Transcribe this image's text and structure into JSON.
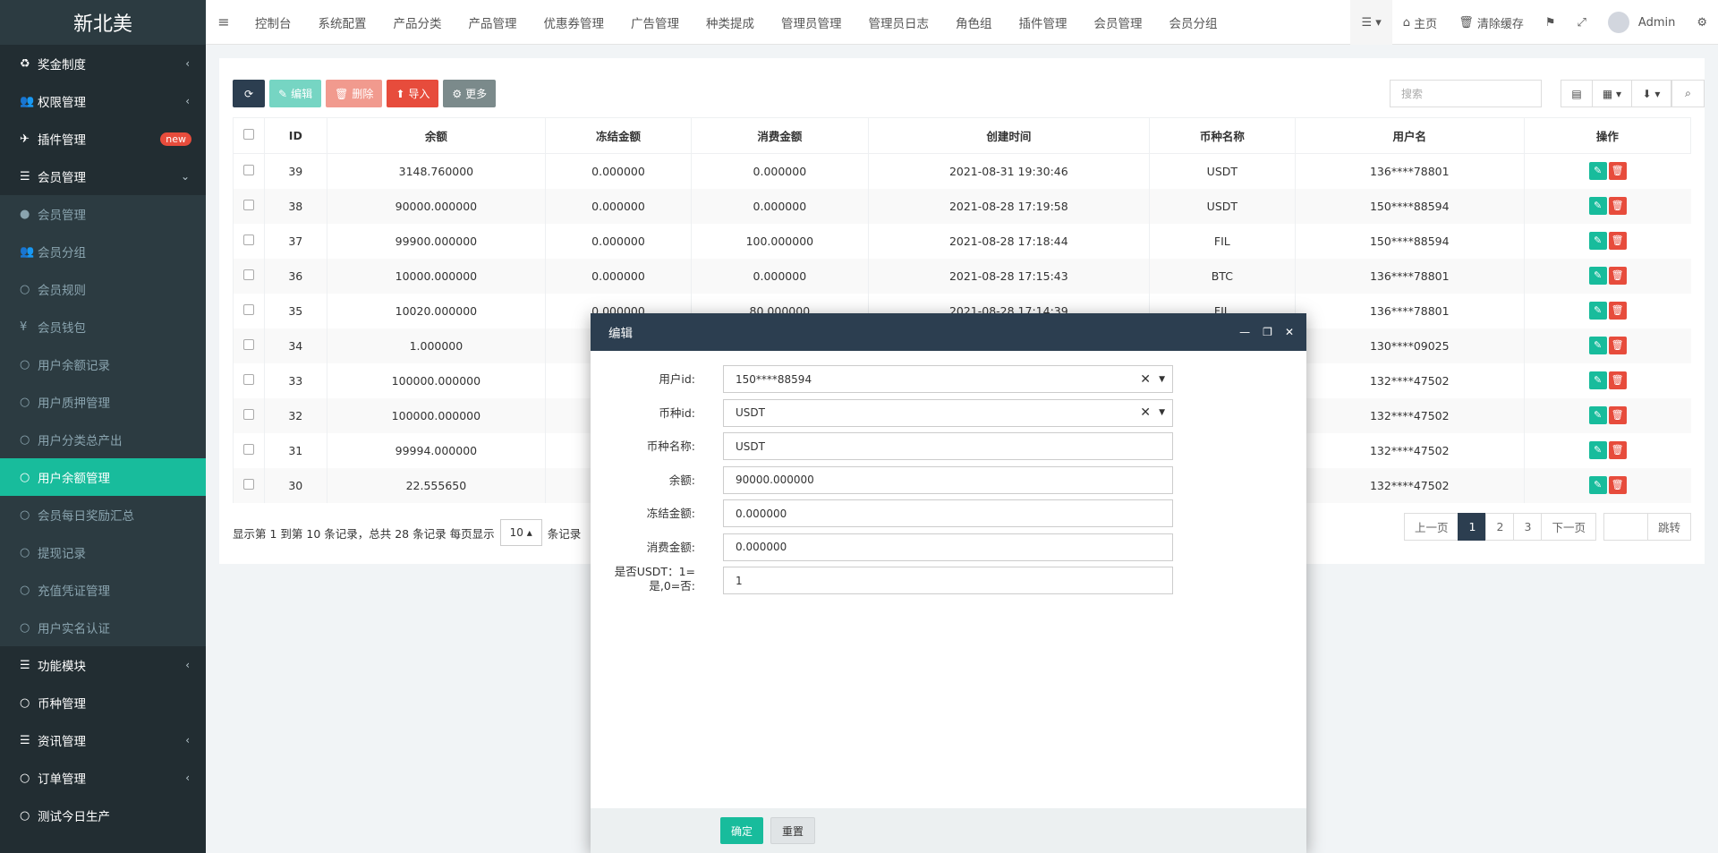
{
  "sidebar": {
    "brand": "新北美",
    "items": [
      {
        "label": "奖金制度",
        "icon": "recycle-icon",
        "glyph": "♻",
        "type": "top",
        "arrow": "‹"
      },
      {
        "label": "权限管理",
        "icon": "users-icon",
        "glyph": "👥",
        "type": "top",
        "arrow": "‹"
      },
      {
        "label": "插件管理",
        "icon": "rocket-icon",
        "glyph": "✈",
        "type": "top",
        "badge": "new"
      },
      {
        "label": "会员管理",
        "icon": "list-icon",
        "glyph": "☰",
        "type": "top",
        "arrow": "⌄"
      },
      {
        "label": "会员管理",
        "icon": "user-icon",
        "glyph": "●",
        "type": "sub"
      },
      {
        "label": "会员分组",
        "icon": "users-icon",
        "glyph": "👥",
        "type": "sub"
      },
      {
        "label": "会员规则",
        "icon": "circle-icon",
        "glyph": "○",
        "type": "sub"
      },
      {
        "label": "会员钱包",
        "icon": "yen-icon",
        "glyph": "¥",
        "type": "sub"
      },
      {
        "label": "用户余额记录",
        "icon": "circle-icon",
        "glyph": "○",
        "type": "sub"
      },
      {
        "label": "用户质押管理",
        "icon": "circle-icon",
        "glyph": "○",
        "type": "sub"
      },
      {
        "label": "用户分类总产出",
        "icon": "circle-icon",
        "glyph": "○",
        "type": "sub"
      },
      {
        "label": "用户余额管理",
        "icon": "circle-icon",
        "glyph": "○",
        "type": "active"
      },
      {
        "label": "会员每日奖励汇总",
        "icon": "circle-icon",
        "glyph": "○",
        "type": "sub"
      },
      {
        "label": "提现记录",
        "icon": "circle-icon",
        "glyph": "○",
        "type": "sub"
      },
      {
        "label": "充值凭证管理",
        "icon": "circle-icon",
        "glyph": "○",
        "type": "sub"
      },
      {
        "label": "用户实名认证",
        "icon": "circle-icon",
        "glyph": "○",
        "type": "sub"
      },
      {
        "label": "功能模块",
        "icon": "list-icon",
        "glyph": "☰",
        "type": "top",
        "arrow": "‹"
      },
      {
        "label": "币种管理",
        "icon": "circle-icon",
        "glyph": "○",
        "type": "top"
      },
      {
        "label": "资讯管理",
        "icon": "list-icon",
        "glyph": "☰",
        "type": "top",
        "arrow": "‹"
      },
      {
        "label": "订单管理",
        "icon": "circle-icon",
        "glyph": "○",
        "type": "top",
        "arrow": "‹"
      },
      {
        "label": "测试今日生产",
        "icon": "circle-icon",
        "glyph": "○",
        "type": "top"
      }
    ]
  },
  "topnav": {
    "toggle": "≡",
    "items": [
      "控制台",
      "系统配置",
      "产品分类",
      "产品管理",
      "优惠券管理",
      "广告管理",
      "种类提成",
      "管理员管理",
      "管理员日志",
      "角色组",
      "插件管理",
      "会员管理",
      "会员分组"
    ],
    "home": "主页",
    "clear_cache": "清除缓存",
    "user": "Admin"
  },
  "toolbar": {
    "refresh": "⟳",
    "edit": "编辑",
    "delete": "删除",
    "import": "导入",
    "more": "更多",
    "search_placeholder": "搜索"
  },
  "table": {
    "columns": [
      "",
      "ID",
      "余额",
      "冻结金额",
      "消费金额",
      "创建时间",
      "币种名称",
      "用户名",
      "操作"
    ],
    "rows": [
      [
        "39",
        "3148.760000",
        "0.000000",
        "0.000000",
        "2021-08-31 19:30:46",
        "USDT",
        "136****78801"
      ],
      [
        "38",
        "90000.000000",
        "0.000000",
        "0.000000",
        "2021-08-28 17:19:58",
        "USDT",
        "150****88594"
      ],
      [
        "37",
        "99900.000000",
        "0.000000",
        "100.000000",
        "2021-08-28 17:18:44",
        "FIL",
        "150****88594"
      ],
      [
        "36",
        "10000.000000",
        "0.000000",
        "0.000000",
        "2021-08-28 17:15:43",
        "BTC",
        "136****78801"
      ],
      [
        "35",
        "10020.000000",
        "0.000000",
        "80.000000",
        "2021-08-28 17:14:39",
        "FIL",
        "136****78801"
      ],
      [
        "34",
        "1.000000",
        "",
        "",
        "",
        "",
        "130****09025"
      ],
      [
        "33",
        "100000.000000",
        "",
        "",
        "",
        "",
        "132****47502"
      ],
      [
        "32",
        "100000.000000",
        "",
        "",
        "",
        "",
        "132****47502"
      ],
      [
        "31",
        "99994.000000",
        "",
        "",
        "",
        "",
        "132****47502"
      ],
      [
        "30",
        "22.555650",
        "",
        "",
        "",
        "",
        "132****47502"
      ]
    ]
  },
  "footer": {
    "info": "显示第 1 到第 10 条记录，总共 28 条记录 每页显示",
    "page_size": "10",
    "suffix": "条记录",
    "prev": "上一页",
    "pages": [
      "1",
      "2",
      "3"
    ],
    "next": "下一页",
    "jump": "跳转"
  },
  "modal": {
    "title": "编辑",
    "fields": [
      {
        "label": "用户id:",
        "value": "150****88594",
        "select": true
      },
      {
        "label": "币种id:",
        "value": "USDT",
        "select": true
      },
      {
        "label": "币种名称:",
        "value": "USDT"
      },
      {
        "label": "余额:",
        "value": "90000.000000"
      },
      {
        "label": "冻结金额:",
        "value": "0.000000"
      },
      {
        "label": "消费金额:",
        "value": "0.000000"
      },
      {
        "label": "是否USDT：1=是,0=否:",
        "value": "1"
      }
    ],
    "confirm": "确定",
    "reset": "重置"
  },
  "colors": {
    "sidebar_bg": "#222d32",
    "active": "#18bc9c",
    "header_dark": "#2c3e50",
    "danger": "#e74c3c"
  }
}
